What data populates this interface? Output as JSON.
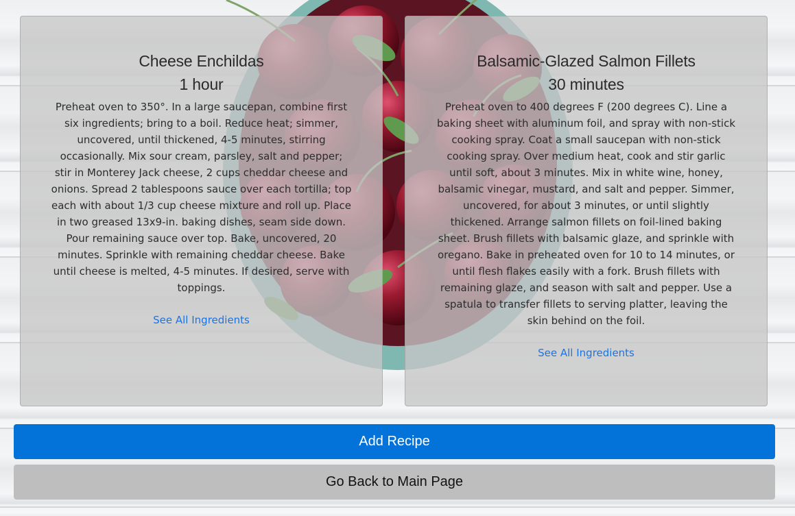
{
  "recipes": [
    {
      "title": "Cheese Enchildas",
      "time": "1 hour",
      "instructions": "Preheat oven to 350°. In a large saucepan, combine first six ingredients; bring to a boil. Reduce heat; simmer, uncovered, until thickened, 4-5 minutes, stirring occasionally. Mix sour cream, parsley, salt and pepper; stir in Monterey Jack cheese, 2 cups cheddar cheese and onions. Spread 2 tablespoons sauce over each tortilla; top each with about 1/3 cup cheese mixture and roll up. Place in two greased 13x9-in. baking dishes, seam side down. Pour remaining sauce over top. Bake, uncovered, 20 minutes. Sprinkle with remaining cheddar cheese. Bake until cheese is melted, 4-5 minutes. If desired, serve with toppings.",
      "link_label": "See All Ingredients"
    },
    {
      "title": "Balsamic-Glazed Salmon Fillets",
      "time": "30 minutes",
      "instructions": "Preheat oven to 400 degrees F (200 degrees C). Line a baking sheet with aluminum foil, and spray with non-stick cooking spray. Coat a small saucepan with non-stick cooking spray. Over medium heat, cook and stir garlic until soft, about 3 minutes. Mix in white wine, honey, balsamic vinegar, mustard, and salt and pepper. Simmer, uncovered, for about 3 minutes, or until slightly thickened. Arrange salmon fillets on foil-lined baking sheet. Brush fillets with balsamic glaze, and sprinkle with oregano. Bake in preheated oven for 10 to 14 minutes, or until flesh flakes easily with a fork. Brush fillets with remaining glaze, and season with salt and pepper. Use a spatula to transfer fillets to serving platter, leaving the skin behind on the foil.",
      "link_label": "See All Ingredients"
    }
  ],
  "actions": {
    "add_recipe_label": "Add Recipe",
    "back_label": "Go Back to Main Page"
  },
  "colors": {
    "primary": "#0373d9",
    "secondary": "#bebebe",
    "link": "#1b74e4"
  }
}
